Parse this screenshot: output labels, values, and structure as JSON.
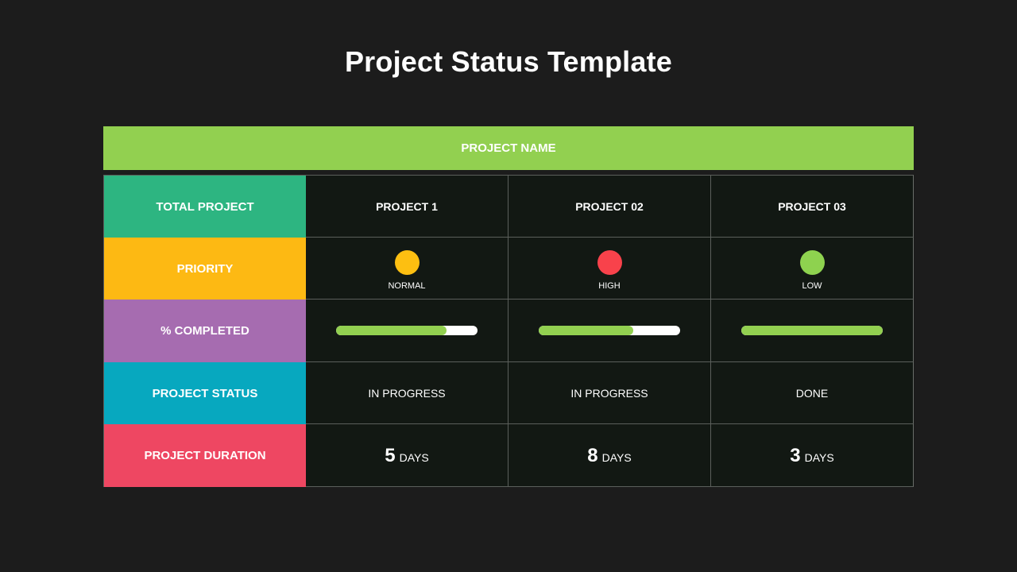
{
  "title": "Project Status Template",
  "header": "PROJECT NAME",
  "row_labels": [
    {
      "text": "TOTAL PROJECT",
      "color": "#2db581"
    },
    {
      "text": "PRIORITY",
      "color": "#fdb913"
    },
    {
      "text": "% COMPLETED",
      "color": "#a66cb0"
    },
    {
      "text": "PROJECT STATUS",
      "color": "#07a8bf"
    },
    {
      "text": "PROJECT DURATION",
      "color": "#ee4762"
    }
  ],
  "projects": [
    {
      "name": "PROJECT 1",
      "priority": {
        "label": "NORMAL",
        "color": "#fdbf11"
      },
      "completed": 0.78,
      "status": "IN PROGRESS",
      "duration": {
        "value": "5",
        "unit": "DAYS"
      }
    },
    {
      "name": "PROJECT 02",
      "priority": {
        "label": "HIGH",
        "color": "#f8424b"
      },
      "completed": 0.67,
      "status": "IN PROGRESS",
      "duration": {
        "value": "8",
        "unit": "DAYS"
      }
    },
    {
      "name": "PROJECT 03",
      "priority": {
        "label": "LOW",
        "color": "#8ed24f"
      },
      "completed": 1.0,
      "status": "DONE",
      "duration": {
        "value": "3",
        "unit": "DAYS"
      }
    }
  ],
  "colors": {
    "background": "#1c1c1c",
    "header_bar": "#92d050",
    "progress_fill": "#92d050",
    "progress_track": "#ffffff",
    "grid_cell": "#121813"
  }
}
